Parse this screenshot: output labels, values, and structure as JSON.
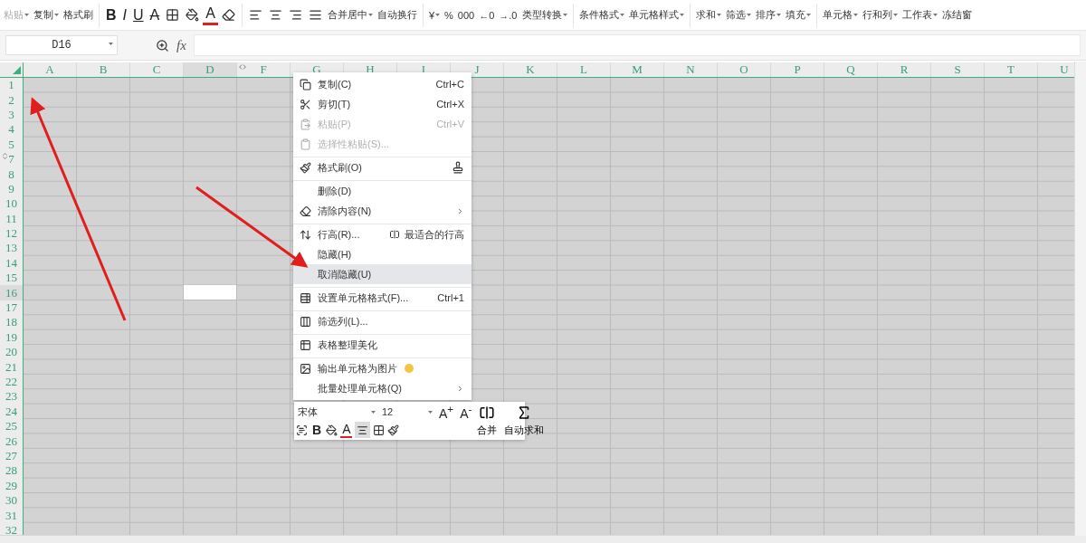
{
  "toolbar": {
    "clipboard": [
      {
        "label": "粘贴",
        "dropdown": true,
        "disabled": true
      },
      {
        "label": "复制",
        "dropdown": true,
        "disabled": false
      },
      {
        "label": "格式刷",
        "dropdown": false,
        "disabled": false
      }
    ],
    "font_glyphs": [
      "B",
      "I",
      "U",
      "A"
    ],
    "font_color_glyph": "A",
    "merge": [
      {
        "label": "合并居中",
        "dropdown": true
      },
      {
        "label": "自动换行",
        "dropdown": false
      }
    ],
    "number": [
      {
        "label": "¥",
        "dropdown": true
      },
      {
        "label": "%",
        "dropdown": false
      },
      {
        "label": "000",
        "dropdown": false
      },
      {
        "label": "←0",
        "dropdown": false
      },
      {
        "label": "→.0",
        "dropdown": false
      },
      {
        "label": "类型转换",
        "dropdown": true
      }
    ],
    "styles": [
      {
        "label": "条件格式",
        "dropdown": true
      },
      {
        "label": "单元格样式",
        "dropdown": true
      }
    ],
    "editing": [
      {
        "label": "求和",
        "dropdown": true
      },
      {
        "label": "筛选",
        "dropdown": true
      },
      {
        "label": "排序",
        "dropdown": true
      },
      {
        "label": "填充",
        "dropdown": true
      }
    ],
    "cells": [
      {
        "label": "单元格",
        "dropdown": true
      },
      {
        "label": "行和列",
        "dropdown": true
      },
      {
        "label": "工作表",
        "dropdown": true
      },
      {
        "label": "冻结窗",
        "dropdown": false
      }
    ]
  },
  "formula_bar": {
    "name_box": "D16",
    "fx": "fx"
  },
  "grid": {
    "columns": [
      {
        "label": "A",
        "selected": false,
        "hidden_before": false
      },
      {
        "label": "B",
        "selected": false,
        "hidden_before": false
      },
      {
        "label": "C",
        "selected": false,
        "hidden_before": false
      },
      {
        "label": "D",
        "selected": true,
        "hidden_before": false
      },
      {
        "label": "F",
        "selected": false,
        "hidden_before": true
      },
      {
        "label": "G",
        "selected": false,
        "hidden_before": false
      },
      {
        "label": "H",
        "selected": false,
        "hidden_before": false
      },
      {
        "label": "I",
        "selected": false,
        "hidden_before": false
      },
      {
        "label": "J",
        "selected": false,
        "hidden_before": false
      },
      {
        "label": "K",
        "selected": false,
        "hidden_before": false
      },
      {
        "label": "L",
        "selected": false,
        "hidden_before": false
      },
      {
        "label": "M",
        "selected": false,
        "hidden_before": false
      },
      {
        "label": "N",
        "selected": false,
        "hidden_before": false
      },
      {
        "label": "O",
        "selected": false,
        "hidden_before": false
      },
      {
        "label": "P",
        "selected": false,
        "hidden_before": false
      },
      {
        "label": "Q",
        "selected": false,
        "hidden_before": false
      },
      {
        "label": "R",
        "selected": false,
        "hidden_before": false
      },
      {
        "label": "S",
        "selected": false,
        "hidden_before": false
      },
      {
        "label": "T",
        "selected": false,
        "hidden_before": false
      },
      {
        "label": "U",
        "selected": false,
        "hidden_before": false
      }
    ],
    "rows": [
      {
        "label": "1",
        "selected": false,
        "hidden_before": false
      },
      {
        "label": "2",
        "selected": false,
        "hidden_before": false
      },
      {
        "label": "3",
        "selected": false,
        "hidden_before": false
      },
      {
        "label": "4",
        "selected": false,
        "hidden_before": false
      },
      {
        "label": "5",
        "selected": false,
        "hidden_before": false
      },
      {
        "label": "7",
        "selected": false,
        "hidden_before": true
      },
      {
        "label": "8",
        "selected": false,
        "hidden_before": false
      },
      {
        "label": "9",
        "selected": false,
        "hidden_before": false
      },
      {
        "label": "10",
        "selected": false,
        "hidden_before": false
      },
      {
        "label": "11",
        "selected": false,
        "hidden_before": false
      },
      {
        "label": "12",
        "selected": false,
        "hidden_before": false
      },
      {
        "label": "13",
        "selected": false,
        "hidden_before": false
      },
      {
        "label": "14",
        "selected": false,
        "hidden_before": false
      },
      {
        "label": "15",
        "selected": false,
        "hidden_before": false
      },
      {
        "label": "16",
        "selected": true,
        "hidden_before": false
      },
      {
        "label": "17",
        "selected": false,
        "hidden_before": false
      },
      {
        "label": "18",
        "selected": false,
        "hidden_before": false
      },
      {
        "label": "19",
        "selected": false,
        "hidden_before": false
      },
      {
        "label": "20",
        "selected": false,
        "hidden_before": false
      },
      {
        "label": "21",
        "selected": false,
        "hidden_before": false
      },
      {
        "label": "22",
        "selected": false,
        "hidden_before": false
      },
      {
        "label": "23",
        "selected": false,
        "hidden_before": false
      },
      {
        "label": "24",
        "selected": false,
        "hidden_before": false
      },
      {
        "label": "25",
        "selected": false,
        "hidden_before": false
      },
      {
        "label": "26",
        "selected": false,
        "hidden_before": false
      },
      {
        "label": "27",
        "selected": false,
        "hidden_before": false
      },
      {
        "label": "28",
        "selected": false,
        "hidden_before": false
      },
      {
        "label": "29",
        "selected": false,
        "hidden_before": false
      },
      {
        "label": "30",
        "selected": false,
        "hidden_before": false
      },
      {
        "label": "31",
        "selected": false,
        "hidden_before": false
      },
      {
        "label": "32",
        "selected": false,
        "hidden_before": false
      }
    ]
  },
  "context_menu": [
    {
      "label": "复制(C)",
      "shortcut": "Ctrl+C",
      "disabled": false,
      "selected": false,
      "submenu": false,
      "separator_before": false
    },
    {
      "label": "剪切(T)",
      "shortcut": "Ctrl+X",
      "disabled": false,
      "selected": false,
      "submenu": false,
      "separator_before": false
    },
    {
      "label": "粘贴(P)",
      "shortcut": "Ctrl+V",
      "disabled": true,
      "selected": false,
      "submenu": false,
      "separator_before": false
    },
    {
      "label": "选择性粘贴(S)...",
      "disabled": true,
      "selected": false,
      "submenu": false,
      "separator_before": false
    },
    {
      "label": "格式刷(O)",
      "disabled": false,
      "selected": false,
      "submenu": false,
      "separator_before": true
    },
    {
      "label": "删除(D)",
      "disabled": false,
      "selected": false,
      "submenu": false,
      "separator_before": true
    },
    {
      "label": "清除内容(N)",
      "disabled": false,
      "selected": false,
      "submenu": true,
      "separator_before": false
    },
    {
      "label": "行高(R)...",
      "extra": "最适合的行高",
      "disabled": false,
      "selected": false,
      "submenu": false,
      "separator_before": true
    },
    {
      "label": "隐藏(H)",
      "disabled": false,
      "selected": false,
      "submenu": false,
      "separator_before": false
    },
    {
      "label": "取消隐藏(U)",
      "disabled": false,
      "selected": true,
      "submenu": false,
      "separator_before": false
    },
    {
      "label": "设置单元格格式(F)...",
      "shortcut": "Ctrl+1",
      "disabled": false,
      "selected": false,
      "submenu": false,
      "separator_before": true
    },
    {
      "label": "筛选列(L)...",
      "disabled": false,
      "selected": false,
      "submenu": false,
      "separator_before": true
    },
    {
      "label": "表格整理美化",
      "disabled": false,
      "selected": false,
      "submenu": false,
      "separator_before": true
    },
    {
      "label": "输出单元格为图片",
      "disabled": false,
      "selected": false,
      "submenu": false,
      "separator_before": true
    },
    {
      "label": "批量处理单元格(Q)",
      "disabled": false,
      "selected": false,
      "submenu": true,
      "separator_before": false
    }
  ],
  "mini_toolbar": {
    "font": "宋体",
    "size": "12",
    "grow_font": "A$^{+}$",
    "shrink_font": "A$^{-}$",
    "bold": "B",
    "font_color": "A",
    "align": {
      "selected": true
    },
    "merge": "合并",
    "autosum": "自动求和"
  }
}
